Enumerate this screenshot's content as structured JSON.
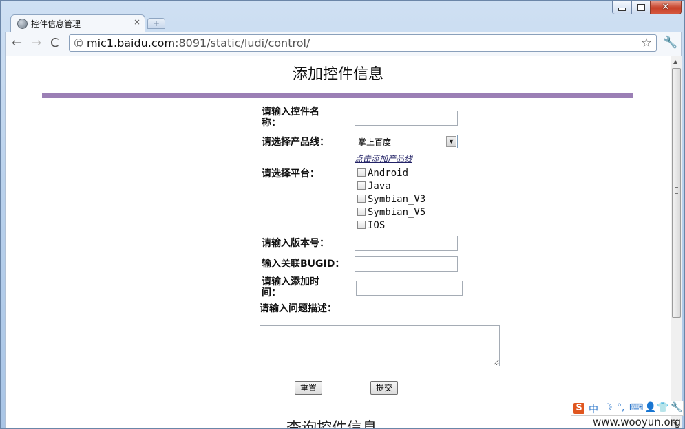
{
  "browser": {
    "tab_title": "控件信息管理",
    "tab_close": "×",
    "new_tab": "+",
    "url_host": "mic1.baidu.com",
    "url_rest": ":8091/static/ludi/control/",
    "nav_back": "←",
    "nav_forward": "→",
    "nav_reload": "C",
    "star": "☆",
    "wrench": "🔧",
    "close": "✕"
  },
  "page": {
    "title": "添加控件信息",
    "next_section_title": "查询控件信息"
  },
  "form": {
    "name_label_1": "请输入控件名",
    "name_label_2": "称：",
    "name_value": "",
    "product_label": "请选择产品线：",
    "product_selected": "掌上百度",
    "add_product_link": "点击添加产品线",
    "platform_label": "请选择平台：",
    "platforms": [
      "Android",
      "Java",
      "Symbian_V3",
      "Symbian_V5",
      "IOS"
    ],
    "version_label": "请输入版本号：",
    "bugid_label": "输入关联BUGID：",
    "time_label_1": "请输入添加时",
    "time_label_2": "间：",
    "desc_label": "请输入问题描述：",
    "reset_button": "重置",
    "submit_button": "提交"
  },
  "ime": {
    "logo": "S",
    "mode": "中",
    "moon": "☽",
    "punct": "°,",
    "keyboard": "⌨",
    "user": "👤",
    "shirt": "👕",
    "tool": "🔧"
  },
  "watermark": "www.wooyun.org"
}
